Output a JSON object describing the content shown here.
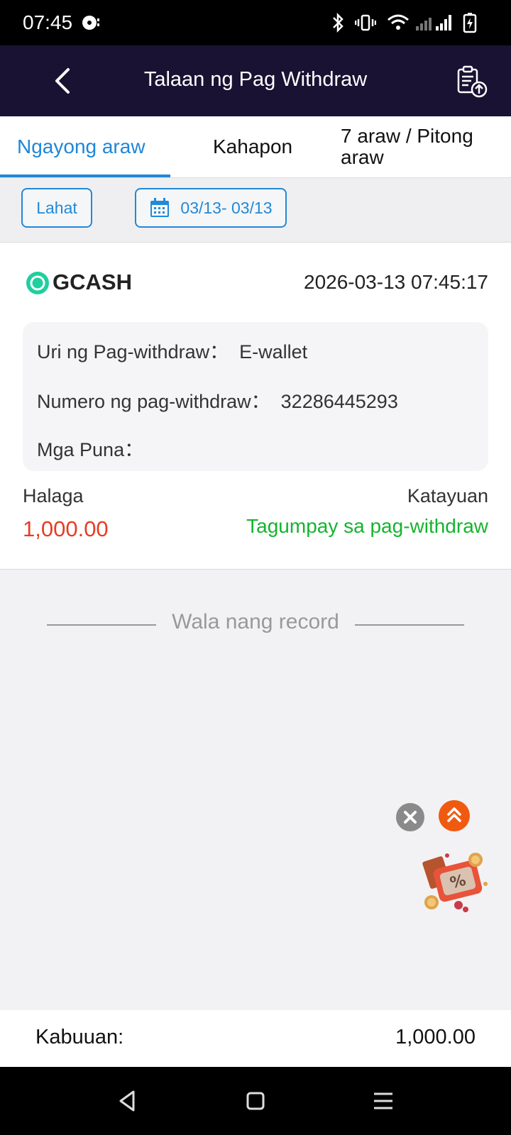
{
  "status_bar": {
    "time": "07:45",
    "icons": [
      "media-icon",
      "bluetooth-icon",
      "vibrate-icon",
      "wifi-icon",
      "signal-icon",
      "battery-charging-icon"
    ]
  },
  "header": {
    "title": "Talaan ng Pag Withdraw",
    "back_icon": "chevron-left-icon",
    "action_icon": "clipboard-upload-icon"
  },
  "tabs": [
    {
      "label": "Ngayong araw",
      "active": true
    },
    {
      "label": "Kahapon",
      "active": false
    },
    {
      "label": "7 araw / Pitong araw",
      "active": false
    }
  ],
  "filters": {
    "type_label": "Lahat",
    "date_range": "03/13- 03/13",
    "date_icon": "calendar-icon"
  },
  "record": {
    "method": "GCASH",
    "timestamp": "2026-03-13 07:45:17",
    "details": [
      {
        "label": "Uri ng Pag-withdraw：",
        "value": "E-wallet"
      },
      {
        "label": "Numero ng pag-withdraw：",
        "value": "32286445293"
      },
      {
        "label": "Mga Puna：",
        "value": ""
      }
    ],
    "amount_label": "Halaga",
    "amount": "1,000.00",
    "status_label": "Katayuan",
    "status": "Tagumpay sa pag-withdraw"
  },
  "no_more_text": "Wala nang record",
  "footer": {
    "total_label": "Kabuuan:",
    "total_value": "1,000.00"
  },
  "colors": {
    "header_bg": "#191232",
    "accent_blue": "#1f86d8",
    "amount_red": "#e53d25",
    "success_green": "#15b42f"
  }
}
